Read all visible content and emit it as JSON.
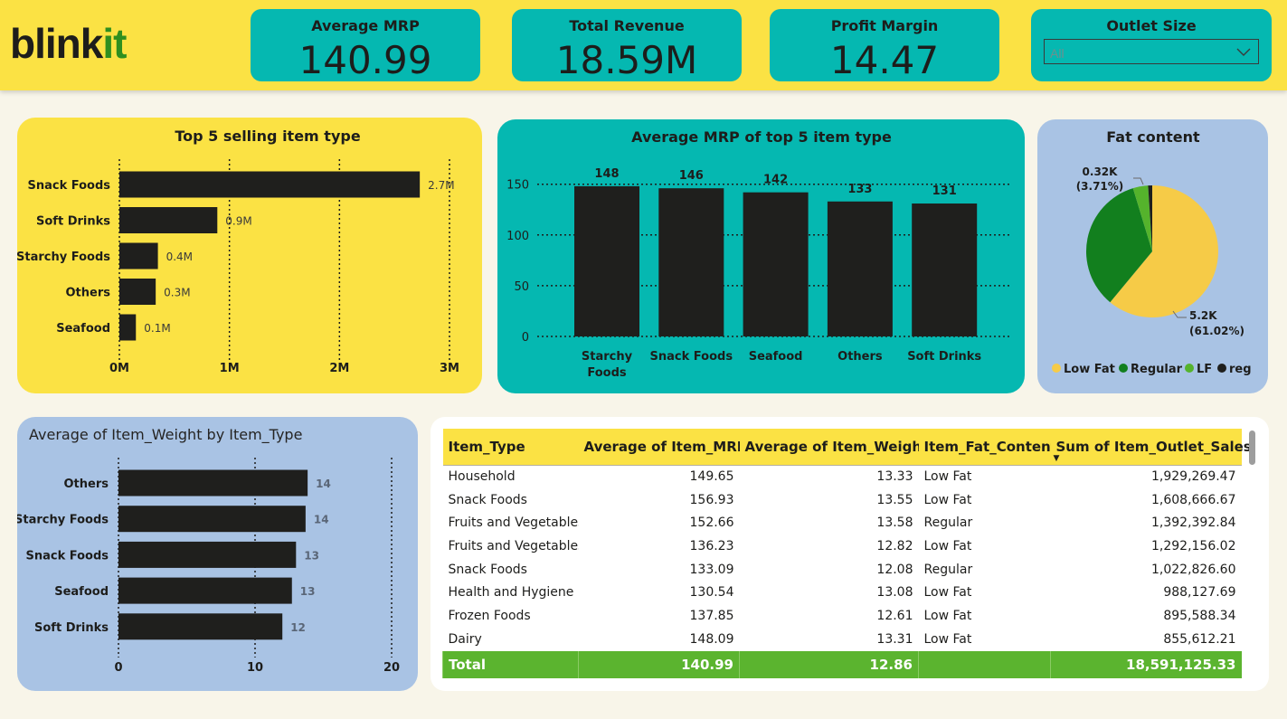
{
  "header": {
    "logo": {
      "text_main": "blink",
      "text_accent": "it"
    },
    "kpis": [
      {
        "title": "Average MRP",
        "value": "140.99"
      },
      {
        "title": "Total Revenue",
        "value": "18.59M"
      },
      {
        "title": "Profit Margin",
        "value": "14.47"
      }
    ],
    "slicer": {
      "title": "Outlet Size",
      "selected": "All"
    }
  },
  "colors": {
    "yellow": "#fbe244",
    "teal": "#05b8b1",
    "blue": "#a9c3e4",
    "bar": "#1f1f1d",
    "green_total": "#5bb42f",
    "pie_low_fat": "#f6cb47",
    "pie_regular": "#127f1e",
    "pie_lf": "#55b32c",
    "pie_reg": "#1f1f1d"
  },
  "charts": {
    "top5": {
      "chart_data": {
        "type": "bar",
        "orientation": "horizontal",
        "title": "Top 5 selling item type",
        "categories": [
          "Snack Foods",
          "Soft Drinks",
          "Starchy Foods",
          "Others",
          "Seafood"
        ],
        "values": [
          2.73,
          0.89,
          0.35,
          0.33,
          0.15
        ],
        "data_labels": [
          "2.7M",
          "0.9M",
          "0.4M",
          "0.3M",
          "0.1M"
        ],
        "x_ticks": [
          "0M",
          "1M",
          "2M",
          "3M"
        ],
        "xlim": [
          0,
          3
        ],
        "grid": true
      }
    },
    "mrp": {
      "chart_data": {
        "type": "bar",
        "title": "Average MRP of top 5 item type",
        "categories": [
          "Starchy Foods",
          "Snack Foods",
          "Seafood",
          "Others",
          "Soft Drinks"
        ],
        "values": [
          148,
          146,
          142,
          133,
          131
        ],
        "data_labels": [
          "148",
          "146",
          "142",
          "133",
          "131"
        ],
        "y_ticks": [
          "0",
          "50",
          "100",
          "150"
        ],
        "ylim": [
          0,
          160
        ],
        "grid": true
      }
    },
    "fat": {
      "chart_data": {
        "type": "pie",
        "title": "Fat content",
        "slices": [
          {
            "name": "Low Fat",
            "value": 61.02
          },
          {
            "name": "Regular",
            "value": 34.27
          },
          {
            "name": "LF",
            "value": 3.71
          },
          {
            "name": "reg",
            "value": 1.0
          }
        ],
        "annotations": [
          {
            "line1": "0.32K",
            "line2": "(3.71%)"
          },
          {
            "line1": "5.2K",
            "line2": "(61.02%)"
          }
        ],
        "legend_position": "bottom"
      }
    },
    "weight": {
      "chart_data": {
        "type": "bar",
        "orientation": "horizontal",
        "title": "Average of Item_Weight by Item_Type",
        "categories": [
          "Others",
          "Starchy Foods",
          "Snack Foods",
          "Seafood",
          "Soft Drinks"
        ],
        "values": [
          13.85,
          13.7,
          13.0,
          12.7,
          12.0
        ],
        "data_labels": [
          "14",
          "14",
          "13",
          "13",
          "12"
        ],
        "x_ticks": [
          "0",
          "10",
          "20"
        ],
        "xlim": [
          0,
          20
        ],
        "grid": true
      }
    }
  },
  "table": {
    "columns": [
      "Item_Type",
      "Average of Item_MRP",
      "Average of Item_Weight",
      "Item_Fat_Content",
      "Sum of Item_Outlet_Sales"
    ],
    "rows": [
      [
        "Household",
        "149.65",
        "13.33",
        "Low Fat",
        "1,929,269.47"
      ],
      [
        "Snack Foods",
        "156.93",
        "13.55",
        "Low Fat",
        "1,608,666.67"
      ],
      [
        "Fruits and Vegetables",
        "152.66",
        "13.58",
        "Regular",
        "1,392,392.84"
      ],
      [
        "Fruits and Vegetables",
        "136.23",
        "12.82",
        "Low Fat",
        "1,292,156.02"
      ],
      [
        "Snack Foods",
        "133.09",
        "12.08",
        "Regular",
        "1,022,826.60"
      ],
      [
        "Health and Hygiene",
        "130.54",
        "13.08",
        "Low Fat",
        "988,127.69"
      ],
      [
        "Frozen Foods",
        "137.85",
        "12.61",
        "Low Fat",
        "895,588.34"
      ],
      [
        "Dairy",
        "148.09",
        "13.31",
        "Low Fat",
        "855,612.21"
      ]
    ],
    "total": [
      "Total",
      "140.99",
      "12.86",
      "",
      "18,591,125.33"
    ]
  }
}
